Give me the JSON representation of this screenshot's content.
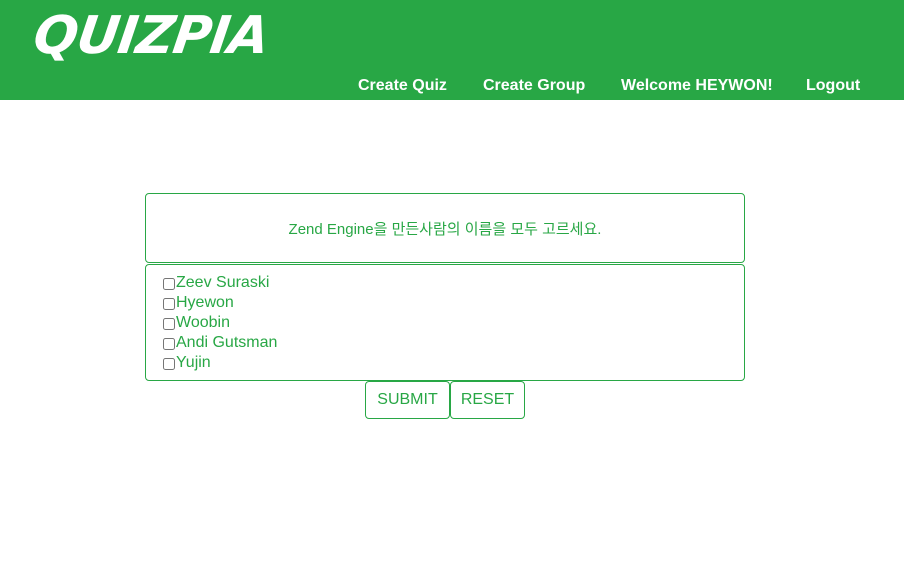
{
  "header": {
    "logo": "QUIZPIA",
    "nav": {
      "create_quiz": "Create Quiz",
      "create_group": "Create Group",
      "welcome": "Welcome HEYWON!",
      "logout": "Logout"
    },
    "background_color": "#28a745"
  },
  "quiz": {
    "question": "Zend Engine을 만든사람의 이름을 모두 고르세요.",
    "options": [
      {
        "label": "Zeev Suraski",
        "checked": false
      },
      {
        "label": "Hyewon",
        "checked": false
      },
      {
        "label": "Woobin",
        "checked": false
      },
      {
        "label": "Andi Gutsman",
        "checked": false
      },
      {
        "label": "Yujin",
        "checked": false
      }
    ],
    "submit_label": "SUBMIT",
    "reset_label": "RESET",
    "accent_color": "#28a745"
  }
}
